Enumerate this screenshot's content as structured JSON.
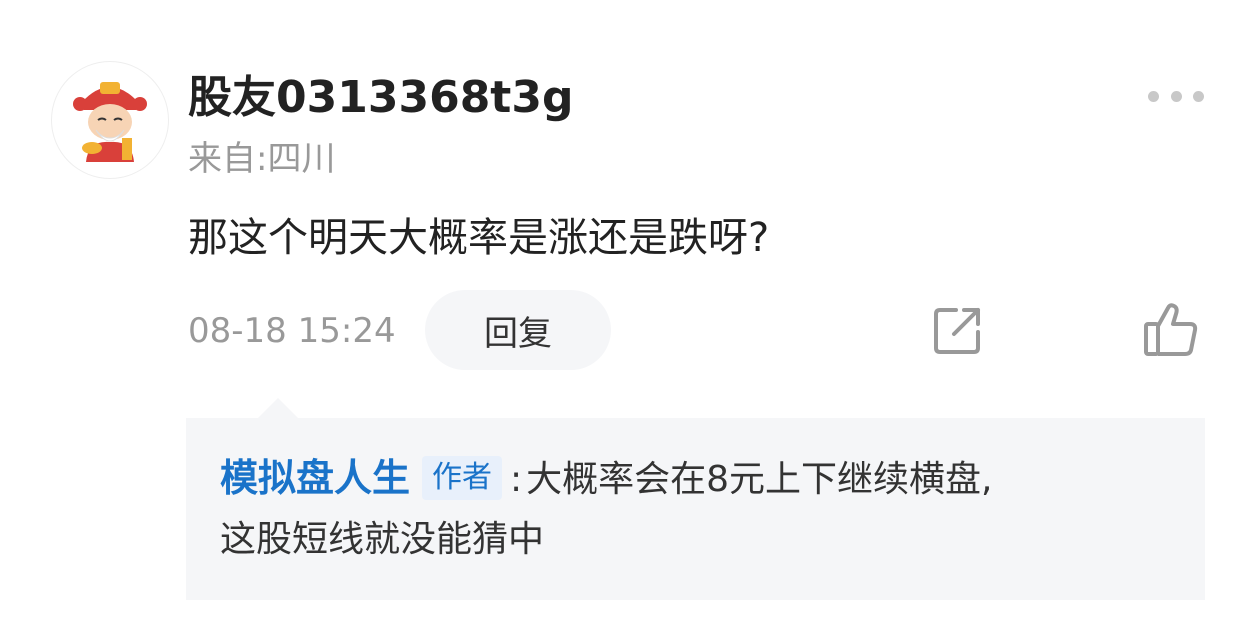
{
  "comment": {
    "username": "股友0313368t3g",
    "location": "来自:四川",
    "text": "那这个明天大概率是涨还是跌呀?",
    "timestamp": "08-18 15:24",
    "reply_label": "回复"
  },
  "reply": {
    "author": "模拟盘人生",
    "badge": "作者",
    "separator": ":",
    "text_line1": "大概率会在8元上下继续横盘,",
    "text_line2": "这股短线就没能猜中"
  },
  "icons": {
    "more": "more-dots-icon",
    "share": "share-icon",
    "like": "thumbs-up-icon",
    "avatar": "god-of-wealth-avatar"
  },
  "colors": {
    "author_blue": "#1a73c9",
    "muted_gray": "#999999",
    "reply_bg": "#f5f6f8"
  }
}
